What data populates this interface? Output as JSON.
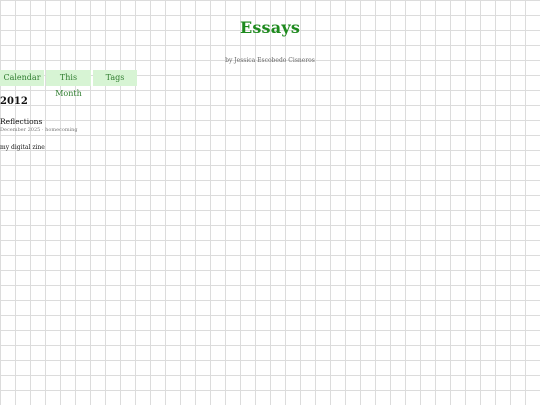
{
  "header": {
    "title": "Essays",
    "byline": "by Jessica Escobedo Cisneros"
  },
  "nav": {
    "tabs": [
      {
        "label": "Calendar"
      },
      {
        "label": "This Month"
      },
      {
        "label": "Tags"
      }
    ]
  },
  "archive": {
    "year": "2012",
    "posts": [
      {
        "title": "Reflections",
        "meta": "December 2025 · homecoming"
      }
    ]
  },
  "footer": {
    "text": "my digital zine"
  },
  "colors": {
    "title": "#1e8a1e",
    "tab_background": "#d7f4d4",
    "tab_text": "#2f7d2f",
    "grid": "#dcdcdc"
  }
}
